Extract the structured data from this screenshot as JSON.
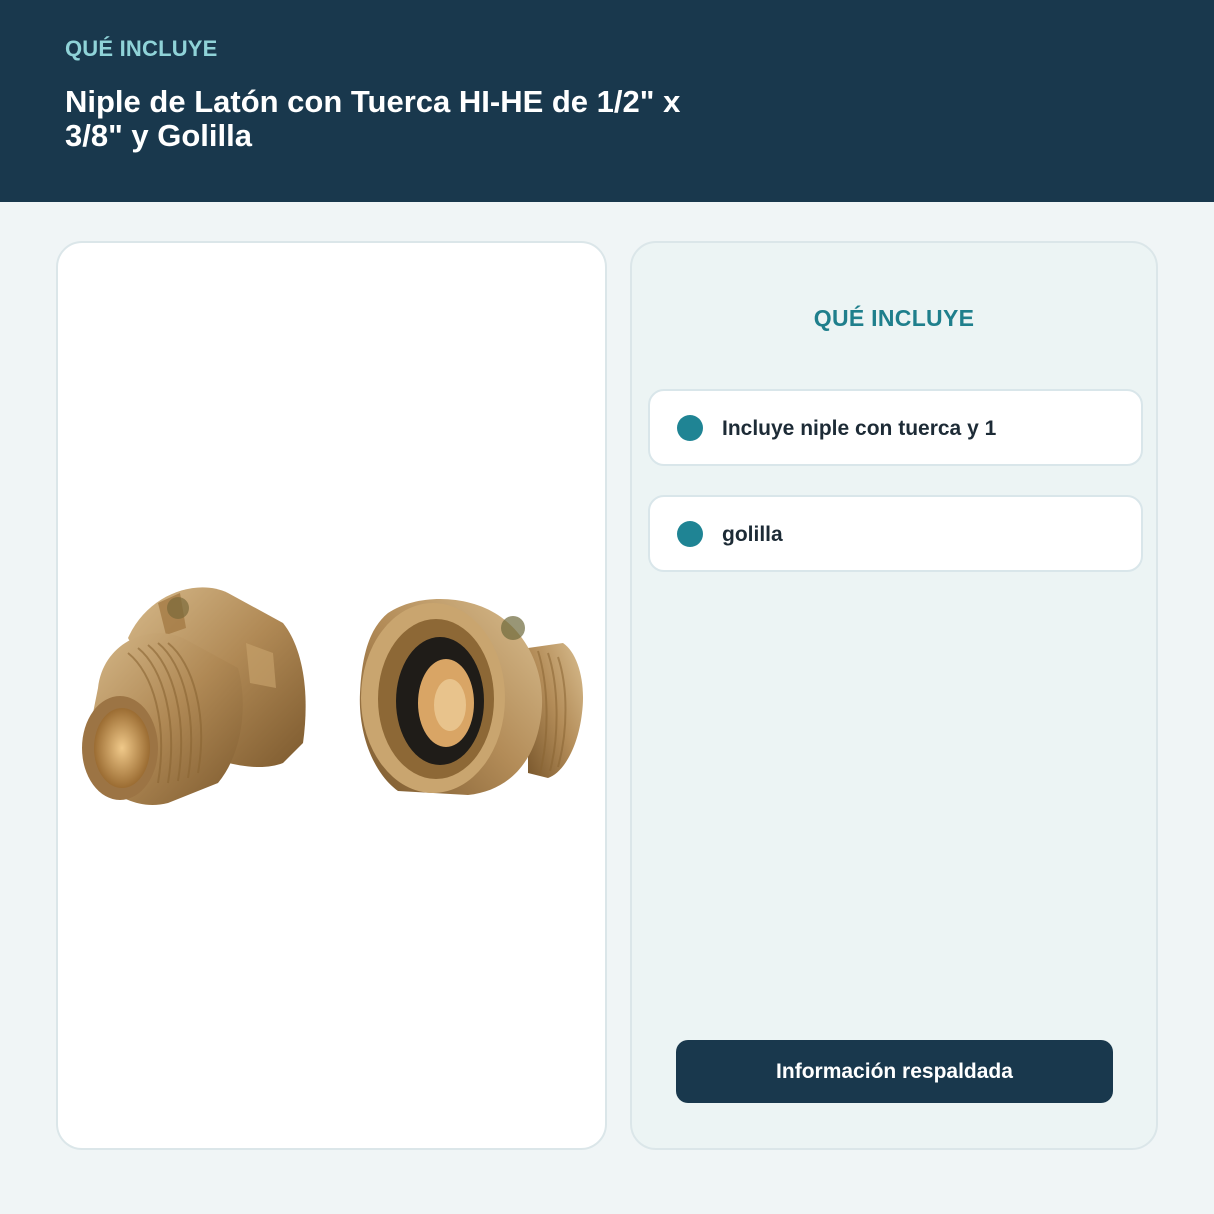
{
  "header": {
    "eyebrow": "QUÉ INCLUYE",
    "title": "Niple de Latón con Tuerca HI-HE de 1/2\" x 3/8\" y Golilla"
  },
  "product_image": {
    "subject": "brass-fittings-photo"
  },
  "info_panel": {
    "heading": "QUÉ INCLUYE",
    "items": [
      {
        "label": "Incluye niple con tuerca y 1"
      },
      {
        "label": "golilla"
      }
    ],
    "cta_label": "Información respaldada"
  },
  "colors": {
    "header_bg": "#19384d",
    "eyebrow": "#8fd3d8",
    "accent": "#1f8494",
    "page_bg": "#f0f5f6",
    "panel_bg": "#ecf4f4"
  }
}
